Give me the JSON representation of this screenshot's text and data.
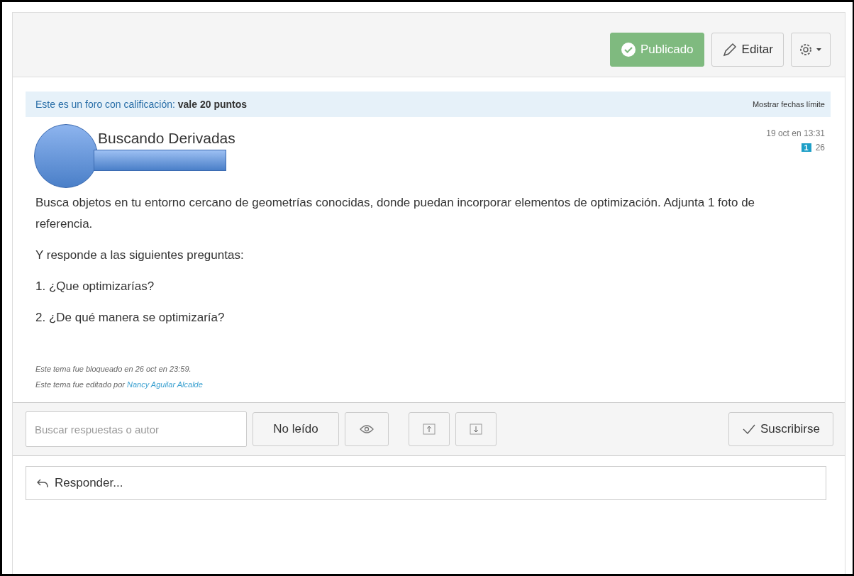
{
  "header": {
    "publish_button": {
      "label": "Publicado",
      "published": true
    },
    "edit_button": "Editar"
  },
  "banner": {
    "text": "Este es un foro con calificación:",
    "points": "vale 20 puntos",
    "link": "Mostrar fechas límite"
  },
  "topic": {
    "title": "Buscando Derivadas",
    "date": "19 oct en 13:31",
    "unread": "1",
    "replies": "26"
  },
  "body": [
    "Busca objetos en tu entorno cercano de geometrías conocidas, donde puedan incorporar elementos de optimización. Adjunta 1 foto de referencia.",
    "Y responde a las siguientes preguntas:",
    "1. ¿Que optimizarías?",
    "2. ¿De qué manera se optimizaría?"
  ],
  "notes": {
    "locked": "Este tema fue bloqueado en 26 oct en 23:59.",
    "edited": "Este tema fue editado por",
    "editor": "Nancy Aguilar Alcalde"
  },
  "toolbar": {
    "search": {
      "placeholder": "Buscar respuestas o autor"
    },
    "unread_button": "No leído",
    "subscribe_button": "Suscribirse"
  },
  "reply": {
    "placeholder": "Responder..."
  }
}
